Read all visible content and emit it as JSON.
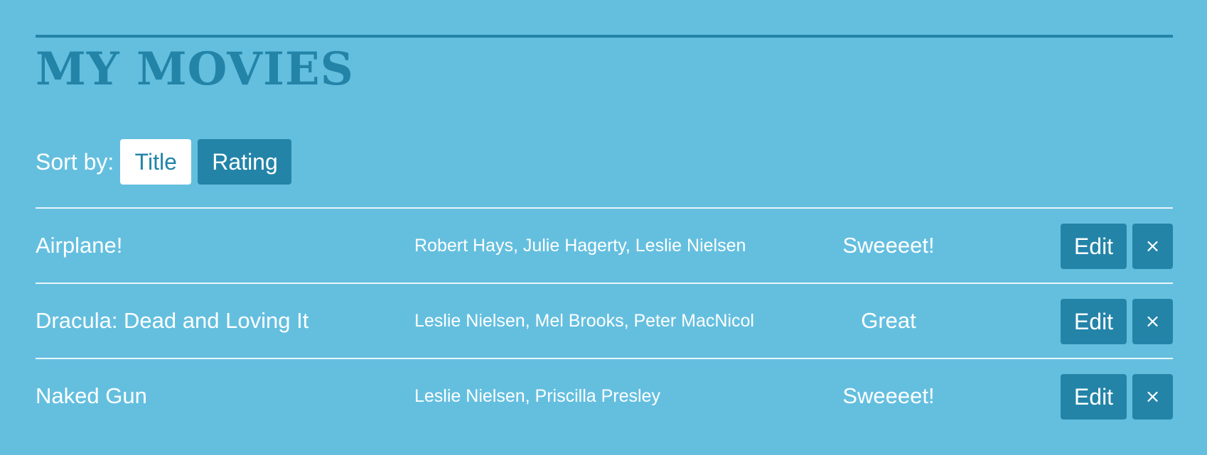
{
  "header": {
    "title": "MY MOVIES"
  },
  "sort": {
    "label": "Sort by:",
    "options": [
      {
        "label": "Title",
        "active": true
      },
      {
        "label": "Rating",
        "active": false
      }
    ]
  },
  "actions": {
    "edit_label": "Edit",
    "delete_glyph": "×"
  },
  "movies": [
    {
      "title": "Airplane!",
      "cast": "Robert Hays, Julie Hagerty, Leslie Nielsen",
      "rating": "Sweeeet!"
    },
    {
      "title": "Dracula: Dead and Loving It",
      "cast": "Leslie Nielsen, Mel Brooks, Peter MacNicol",
      "rating": "Great"
    },
    {
      "title": "Naked Gun",
      "cast": "Leslie Nielsen, Priscilla Presley",
      "rating": "Sweeeet!"
    }
  ],
  "colors": {
    "background": "#64bfdf",
    "accent": "#2384a8",
    "text": "#ffffff"
  }
}
